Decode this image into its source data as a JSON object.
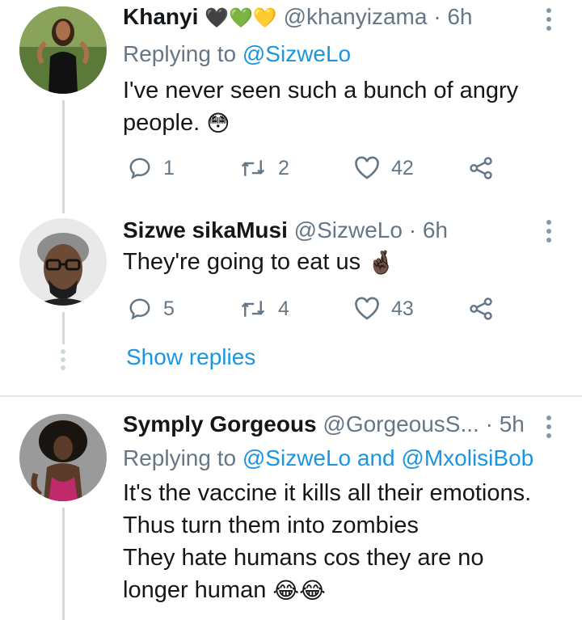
{
  "tweets": [
    {
      "name": "Khanyi",
      "badges": "🖤💚💛",
      "handle": "@khanyizama",
      "dot": "·",
      "time": "6h",
      "replying_prefix": "Replying to",
      "replying_to": "@SizweLo",
      "text_line1": "I've never seen such a bunch of angry",
      "text_line2": "people.",
      "emoji": "😳",
      "replies": "1",
      "retweets": "2",
      "likes": "42"
    },
    {
      "name": "Sizwe sikaMusi",
      "handle": "@SizweLo",
      "dot": "·",
      "time": "6h",
      "text": "They're going to eat us",
      "emoji": "🤞🏿",
      "replies": "5",
      "retweets": "4",
      "likes": "43"
    },
    {
      "name": "Symply Gorgeous",
      "handle": "@GorgeousS...",
      "dot": "·",
      "time": "5h",
      "replying_prefix": "Replying to",
      "replying_to": "@SizweLo and @MxolisiBob",
      "text_line1": "It's the vaccine it kills all their emotions.",
      "text_line2": "Thus turn them into zombies",
      "text_line3": "They hate humans cos they are no",
      "text_line4": "longer human",
      "emoji": "😂😂"
    }
  ],
  "show_replies": "Show replies",
  "colors": {
    "accent": "#1b95e0",
    "muted": "#657786",
    "line": "#cfd9de"
  }
}
